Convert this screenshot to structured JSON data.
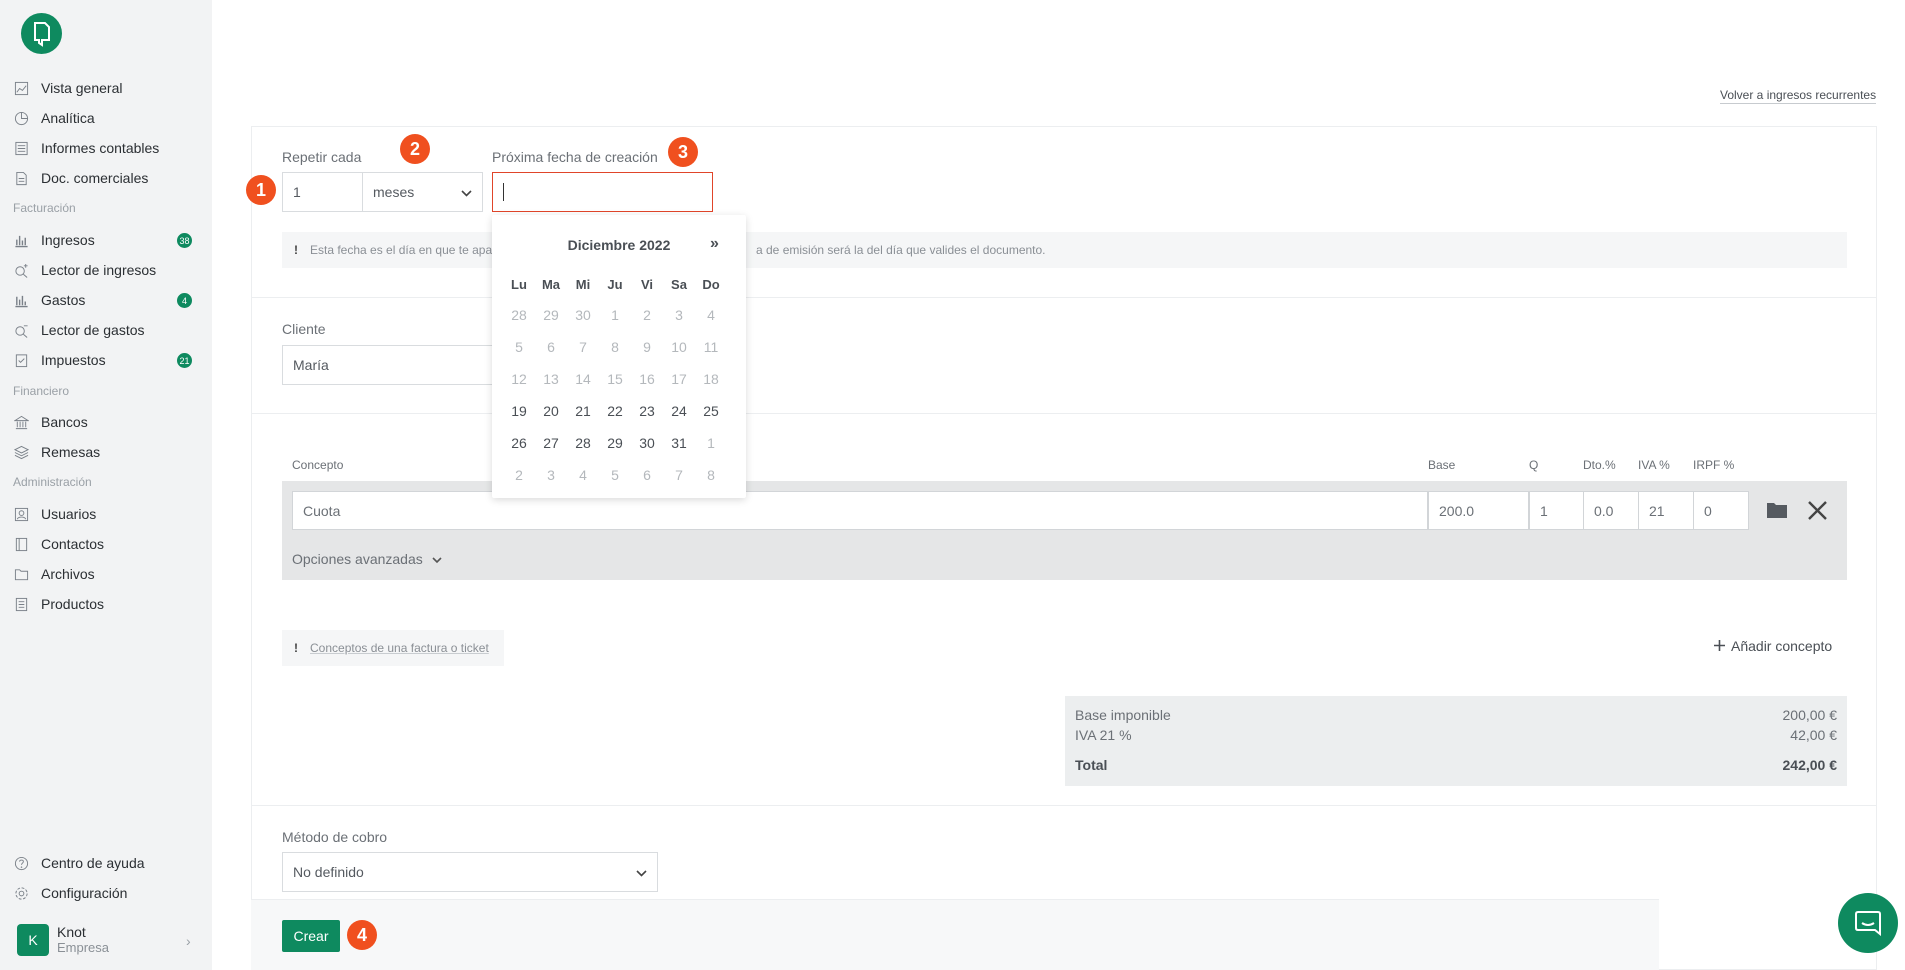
{
  "sidebar": {
    "items": [
      {
        "label": "Vista general"
      },
      {
        "label": "Analítica"
      },
      {
        "label": "Informes contables"
      },
      {
        "label": "Doc. comerciales"
      },
      {
        "label": "Ingresos",
        "badge": "38"
      },
      {
        "label": "Lector de ingresos"
      },
      {
        "label": "Gastos",
        "badge": "4"
      },
      {
        "label": "Lector de gastos"
      },
      {
        "label": "Impuestos",
        "badge": "21"
      },
      {
        "label": "Bancos"
      },
      {
        "label": "Remesas"
      },
      {
        "label": "Usuarios"
      },
      {
        "label": "Contactos"
      },
      {
        "label": "Archivos"
      },
      {
        "label": "Productos"
      },
      {
        "label": "Centro de ayuda"
      },
      {
        "label": "Configuración"
      }
    ],
    "sections": {
      "facturacion": "Facturación",
      "financiero": "Financiero",
      "administracion": "Administración"
    },
    "user": {
      "initial": "K",
      "name": "Knot",
      "role": "Empresa"
    }
  },
  "header": {
    "back_link": "Volver a ingresos recurrentes"
  },
  "repeat": {
    "label": "Repetir cada",
    "value": "1",
    "unit": "meses"
  },
  "next_date": {
    "label": "Próxima fecha de creación",
    "value": ""
  },
  "steps": [
    "1",
    "2",
    "3",
    "4"
  ],
  "date_note": {
    "bang": "!",
    "text_left": "Esta fecha es el día en que te apa",
    "text_right": "a de emisión será la del día que valides el documento."
  },
  "datepicker": {
    "title": "Diciembre 2022",
    "next": "»",
    "weekdays": [
      "Lu",
      "Ma",
      "Mi",
      "Ju",
      "Vi",
      "Sa",
      "Do"
    ],
    "weeks": [
      [
        "28",
        "29",
        "30",
        "1",
        "2",
        "3",
        "4"
      ],
      [
        "5",
        "6",
        "7",
        "8",
        "9",
        "10",
        "11"
      ],
      [
        "12",
        "13",
        "14",
        "15",
        "16",
        "17",
        "18"
      ],
      [
        "19",
        "20",
        "21",
        "22",
        "23",
        "24",
        "25"
      ],
      [
        "26",
        "27",
        "28",
        "29",
        "30",
        "31",
        "1"
      ],
      [
        "2",
        "3",
        "4",
        "5",
        "6",
        "7",
        "8"
      ]
    ]
  },
  "cliente": {
    "label": "Cliente",
    "value": "María"
  },
  "concepts": {
    "headers": {
      "concepto": "Concepto",
      "base": "Base",
      "q": "Q",
      "dto": "Dto.%",
      "iva": "IVA %",
      "irpf": "IRPF %"
    },
    "row": {
      "concepto": "Cuota",
      "base": "200.0",
      "q": "1",
      "dto": "0.0",
      "iva": "21",
      "irpf": "0"
    },
    "advanced": "Opciones avanzadas",
    "note_bang": "!",
    "note": "Conceptos de una factura o ticket",
    "add": "Añadir concepto"
  },
  "totals": {
    "base_label": "Base imponible",
    "base_value": "200,00 €",
    "iva_label": "IVA 21 %",
    "iva_value": "42,00 €",
    "total_label": "Total",
    "total_value": "242,00 €"
  },
  "metodo": {
    "label": "Método de cobro",
    "value": "No definido"
  },
  "actions": {
    "crear": "Crear"
  },
  "colors": {
    "brand": "#0e8a5f",
    "step": "#f0501f",
    "error": "#e0452a"
  }
}
